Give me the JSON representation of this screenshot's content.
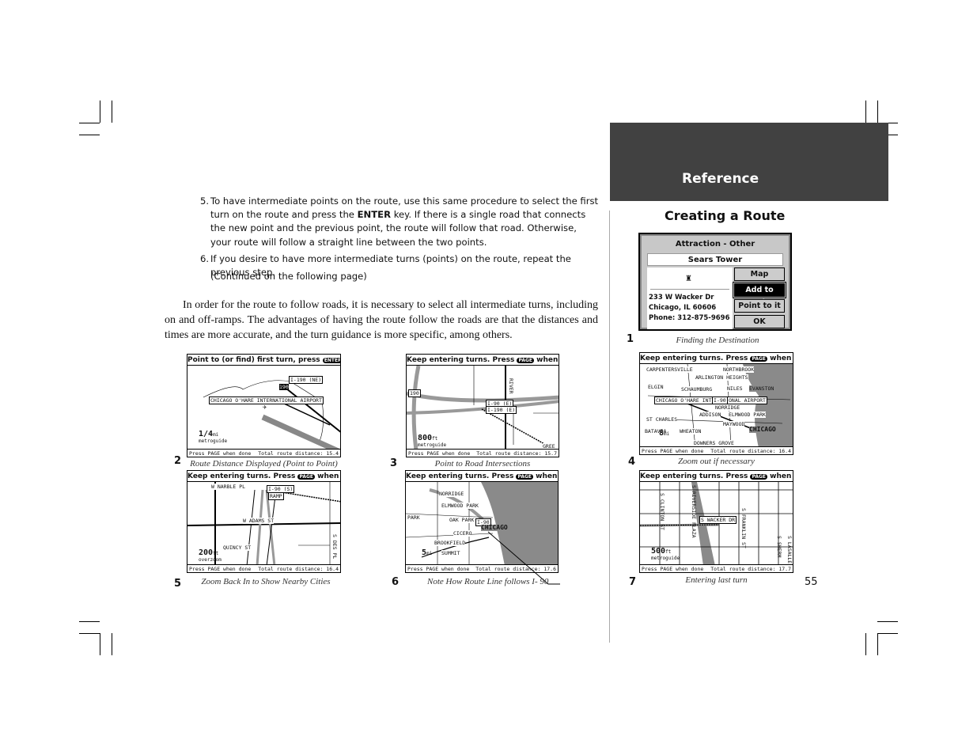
{
  "header": {
    "section": "Reference",
    "title": "Creating a Route",
    "page_number": "55"
  },
  "steps": [
    {
      "num": "5.",
      "text_before": "To have intermediate points on the route, use this same procedure to select the first turn on the route and press the ",
      "key": "ENTER",
      "text_after": " key.  If there is a single road that connects the new point and the previous point, the route will follow that road.  Otherwise, your route will follow a straight line between the two points."
    },
    {
      "num": "6.",
      "text": "If you desire to have more intermediate turns (points) on the route, repeat the previous step."
    }
  ],
  "continued": "(Continued on the following page)",
  "paragraph": "In order for the route to follow roads, it is necessary to select all intermediate turns, including on and off-ramps. The advantages of having the route follow the roads are that the distances and times are more accurate, and the turn guidance is more specific, among others.",
  "figures": {
    "f1": {
      "num": "1",
      "caption": "Finding the Destination",
      "title": "Attraction - Other",
      "name": "Sears Tower",
      "icon": "building-icon",
      "address": [
        "233 W Wacker Dr",
        "Chicago, IL  60606",
        "Phone:  312-875-9696"
      ],
      "buttons": [
        "Map",
        "Add to route",
        "Point to it",
        "OK"
      ],
      "selected": "Add to route"
    },
    "f2": {
      "num": "2",
      "caption": "Route Distance Displayed (Point to Point)",
      "title": "Point to (or find) first turn, press",
      "key": "ENTER",
      "bottom_left": "Press PAGE when done",
      "bottom_right": "Total route distance:  15.4",
      "labels": [
        "I-190 (NE)",
        "190",
        "CHICAGO O'HARE INTERNATIONAL AIRPORT"
      ],
      "scale": "1/4",
      "scale_unit": "mi",
      "scale_source": "metroguide"
    },
    "f3": {
      "num": "3",
      "caption": "Point to Road Intersections",
      "title_a": "Keep entering turns. Press",
      "key": "PAGE",
      "title_b": "when done",
      "bottom_left": "Press PAGE when done",
      "bottom_right": "Total route distance:  15.7",
      "labels": [
        "I-90 (E)",
        "I-190 (E)",
        "190",
        "RIVER",
        "GREE"
      ],
      "scale": "800",
      "scale_unit": "ft",
      "scale_source": "metroguide"
    },
    "f4": {
      "num": "4",
      "caption": "Zoom out if necessary",
      "title_a": "Keep entering turns. Press",
      "key": "PAGE",
      "title_b": "when done",
      "bottom_left": "Press PAGE when done",
      "bottom_right": "Total route distance:  16.4",
      "labels": [
        "CARPENTERSVILLE",
        "NORTHBROOK",
        "ARLINGTON HEIGHTS",
        "ELGIN",
        "SCHAUMBURG",
        "NILES",
        "EVANSTON",
        "CHICAGO O'HARE INTE",
        "I-90",
        "ONAL AIRPORT",
        "NORRIDGE",
        "ADDISON",
        "ELMWOOD PARK",
        "ST CHARLES",
        "MAYWOOD",
        "BATAVIA",
        "WHEATON",
        "CHICAGO",
        "DOWNERS GROVE"
      ],
      "scale": "8",
      "scale_unit": "mi"
    },
    "f5": {
      "num": "5",
      "caption": "Zoom Back In to Show Nearby Cities",
      "title_a": "Keep entering turns. Press",
      "key": "PAGE",
      "title_b": "when done",
      "bottom_left": "Press PAGE when done",
      "bottom_right": "Total route distance:  16.4",
      "labels": [
        "W NARBLE PL",
        "I-90 (S)",
        "RAMP",
        "W ADAMS ST",
        "QUINCY ST",
        "S DES PL"
      ],
      "scale": "200",
      "scale_unit": "ft",
      "scale_source": "overzoom"
    },
    "f6": {
      "num": "6",
      "caption": "Note How Route Line follows I- 90",
      "title_a": "Keep entering turns. Press",
      "key": "PAGE",
      "title_b": "when done",
      "bottom_left": "Press PAGE when done",
      "bottom_right": "Total route distance:  17.6",
      "labels": [
        "NORRIDGE",
        "ELMWOOD PARK",
        "OAK PARK",
        "I-90",
        "CHICAGO",
        "CICERO",
        "BROOKFIELD",
        "SUMMIT",
        "PARK"
      ],
      "scale": "5",
      "scale_unit": "mi"
    },
    "f7": {
      "num": "7",
      "caption": "Entering last turn",
      "title_a": "Keep entering turns. Press",
      "key": "PAGE",
      "title_b": "when done",
      "bottom_left": "Press PAGE when done",
      "bottom_right": "Total route distance:  17.7",
      "labels": [
        "S CLINTON ST",
        "S RIVERSIDE PLAZA",
        "S WACKER DR",
        "S FRANKLIN ST",
        "S SHERM",
        "S LASALLE"
      ],
      "scale": "500",
      "scale_unit": "ft",
      "scale_source": "metroguide"
    }
  },
  "colors": {
    "band": "#414141",
    "water": "#8a8a8a",
    "route": "#999999"
  }
}
